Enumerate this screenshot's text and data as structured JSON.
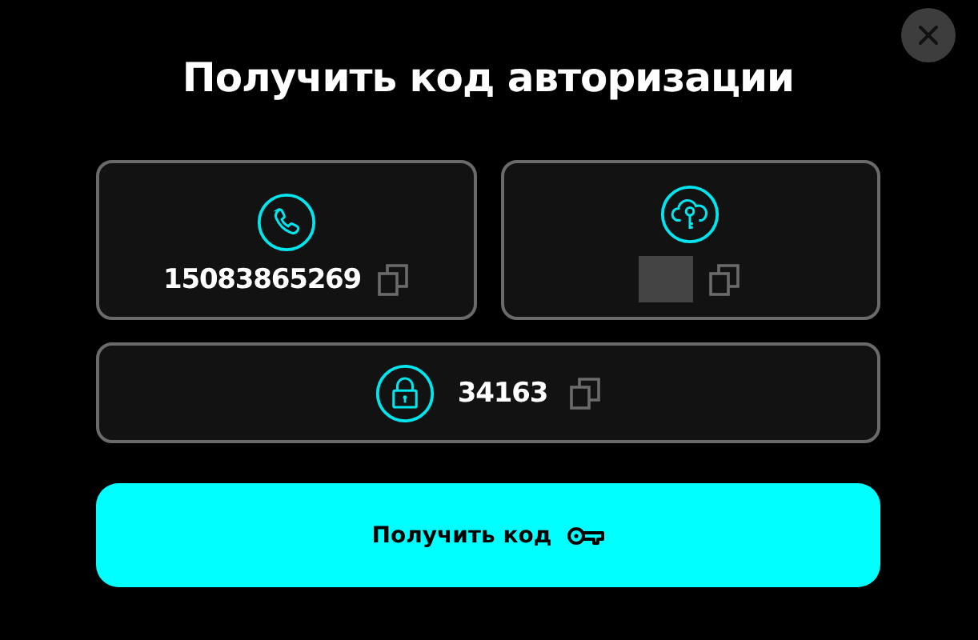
{
  "title": "Получить код авторизации",
  "credentials": [
    {
      "kind": "phone",
      "value": "15083865269",
      "masked": false
    },
    {
      "kind": "cloud-key",
      "masked": true
    }
  ],
  "code": {
    "kind": "lock",
    "value": "34163"
  },
  "button": {
    "label": "Получить код"
  }
}
